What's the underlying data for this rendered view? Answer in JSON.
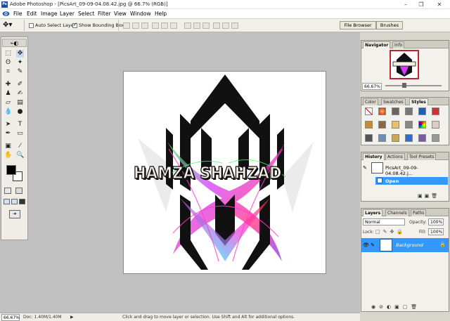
{
  "window": {
    "app_title": "Adobe Photoshop - [PicsArt_09-09-04.08.42.jpg @ 66.7% (RGB)]",
    "minimize": "–",
    "restore": "❐",
    "close": "✕"
  },
  "menu": [
    "File",
    "Edit",
    "Image",
    "Layer",
    "Select",
    "Filter",
    "View",
    "Window",
    "Help"
  ],
  "options": {
    "auto_select": "Auto Select Layer",
    "bounding_box": "Show Bounding Box"
  },
  "palette_well": {
    "file_browser": "File Browser",
    "brushes": "Brushes"
  },
  "canvas": {
    "text": "HAMZA SHAHZAD"
  },
  "navigator": {
    "tabs": [
      "Navigator",
      "Info"
    ],
    "zoom": "66.67%"
  },
  "color_panel": {
    "tabs": [
      "Color",
      "Swatches",
      "Styles"
    ]
  },
  "history": {
    "tabs": [
      "History",
      "Actions",
      "Tool Presets"
    ],
    "snapshot": "PicsArt_09-09-04.08.42.j...",
    "state": "Open"
  },
  "layers": {
    "tabs": [
      "Layers",
      "Channels",
      "Paths"
    ],
    "blend_mode": "Normal",
    "opacity_label": "Opacity:",
    "opacity_value": "100%",
    "lock_label": "Lock:",
    "fill_label": "Fill:",
    "fill_value": "100%",
    "layer_name": "Background"
  },
  "status": {
    "zoom": "66.67%",
    "doc": "Doc: 1.40M/1.40M",
    "message": "Click and drag to move layer or selection.  Use Shift and Alt for additional options."
  },
  "colors": {
    "selection": "#3399ff",
    "workspace": "#c0c0c0",
    "accent_red": "#c0232b"
  }
}
